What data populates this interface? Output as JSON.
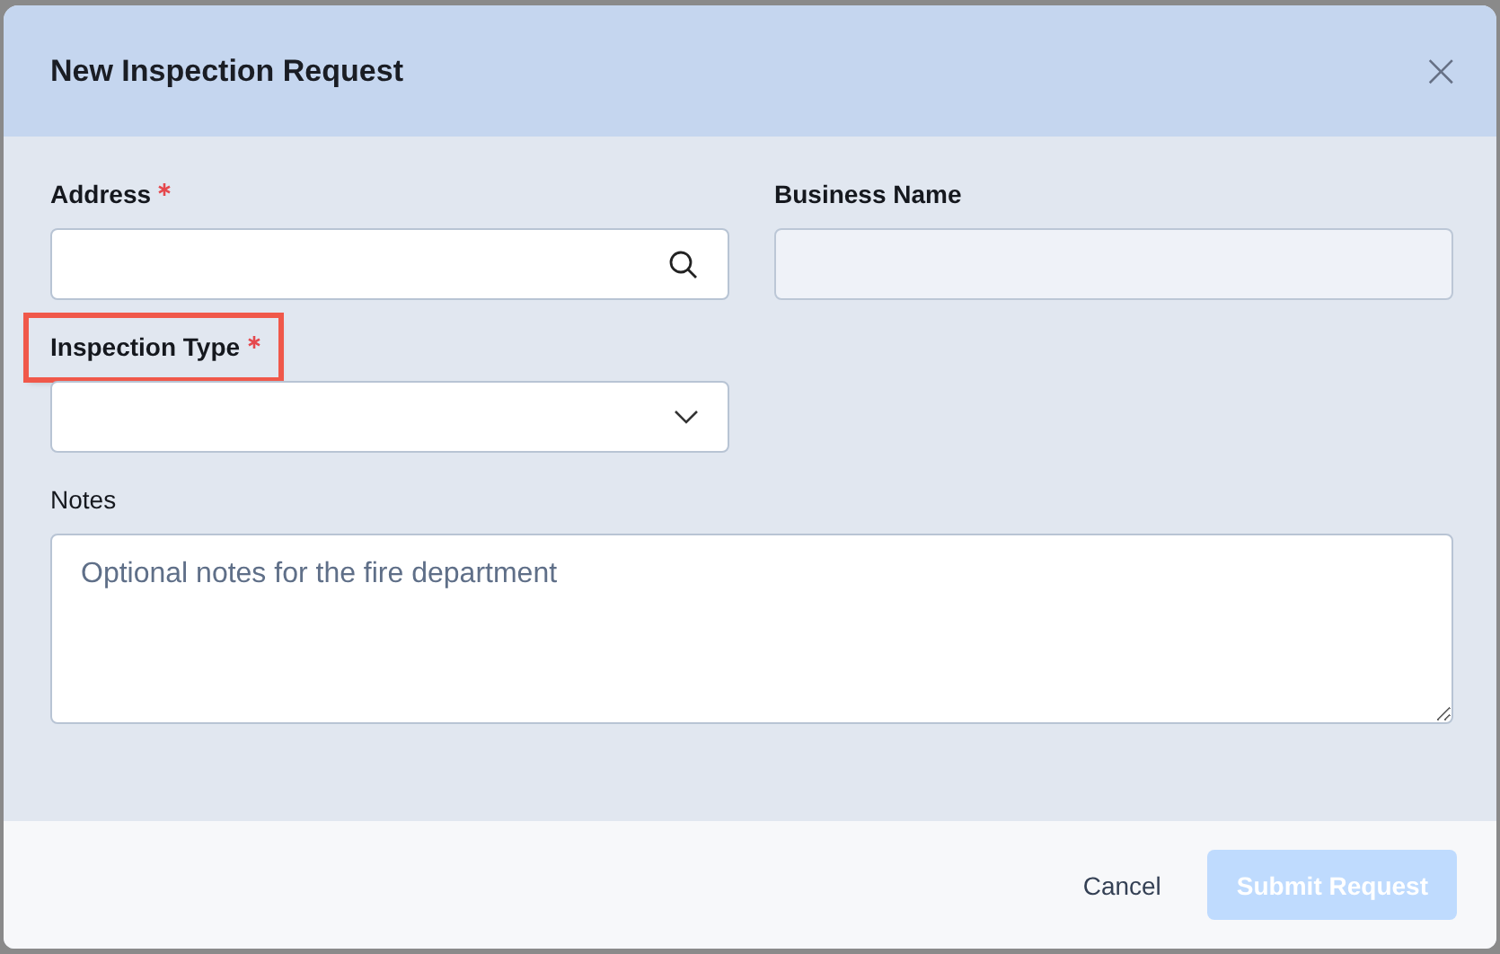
{
  "dialog": {
    "title": "New Inspection Request",
    "close": "×"
  },
  "fields": [
    {
      "kind": "search",
      "label": "Address",
      "required": true,
      "highlighted": false
    },
    {
      "kind": "readonly",
      "label": "Business Name",
      "required": false,
      "highlighted": false
    },
    {
      "kind": "select",
      "label": "Inspection Type",
      "required": true,
      "highlighted": true
    },
    {
      "kind": "textarea",
      "label": "Notes",
      "required": false,
      "highlighted": false,
      "placeholder": "Optional notes for the fire department"
    }
  ],
  "buttons": [
    {
      "kind": "secondary",
      "label": "Cancel",
      "disabled": false
    },
    {
      "kind": "primary",
      "label": "Submit Request",
      "disabled": true
    }
  ]
}
